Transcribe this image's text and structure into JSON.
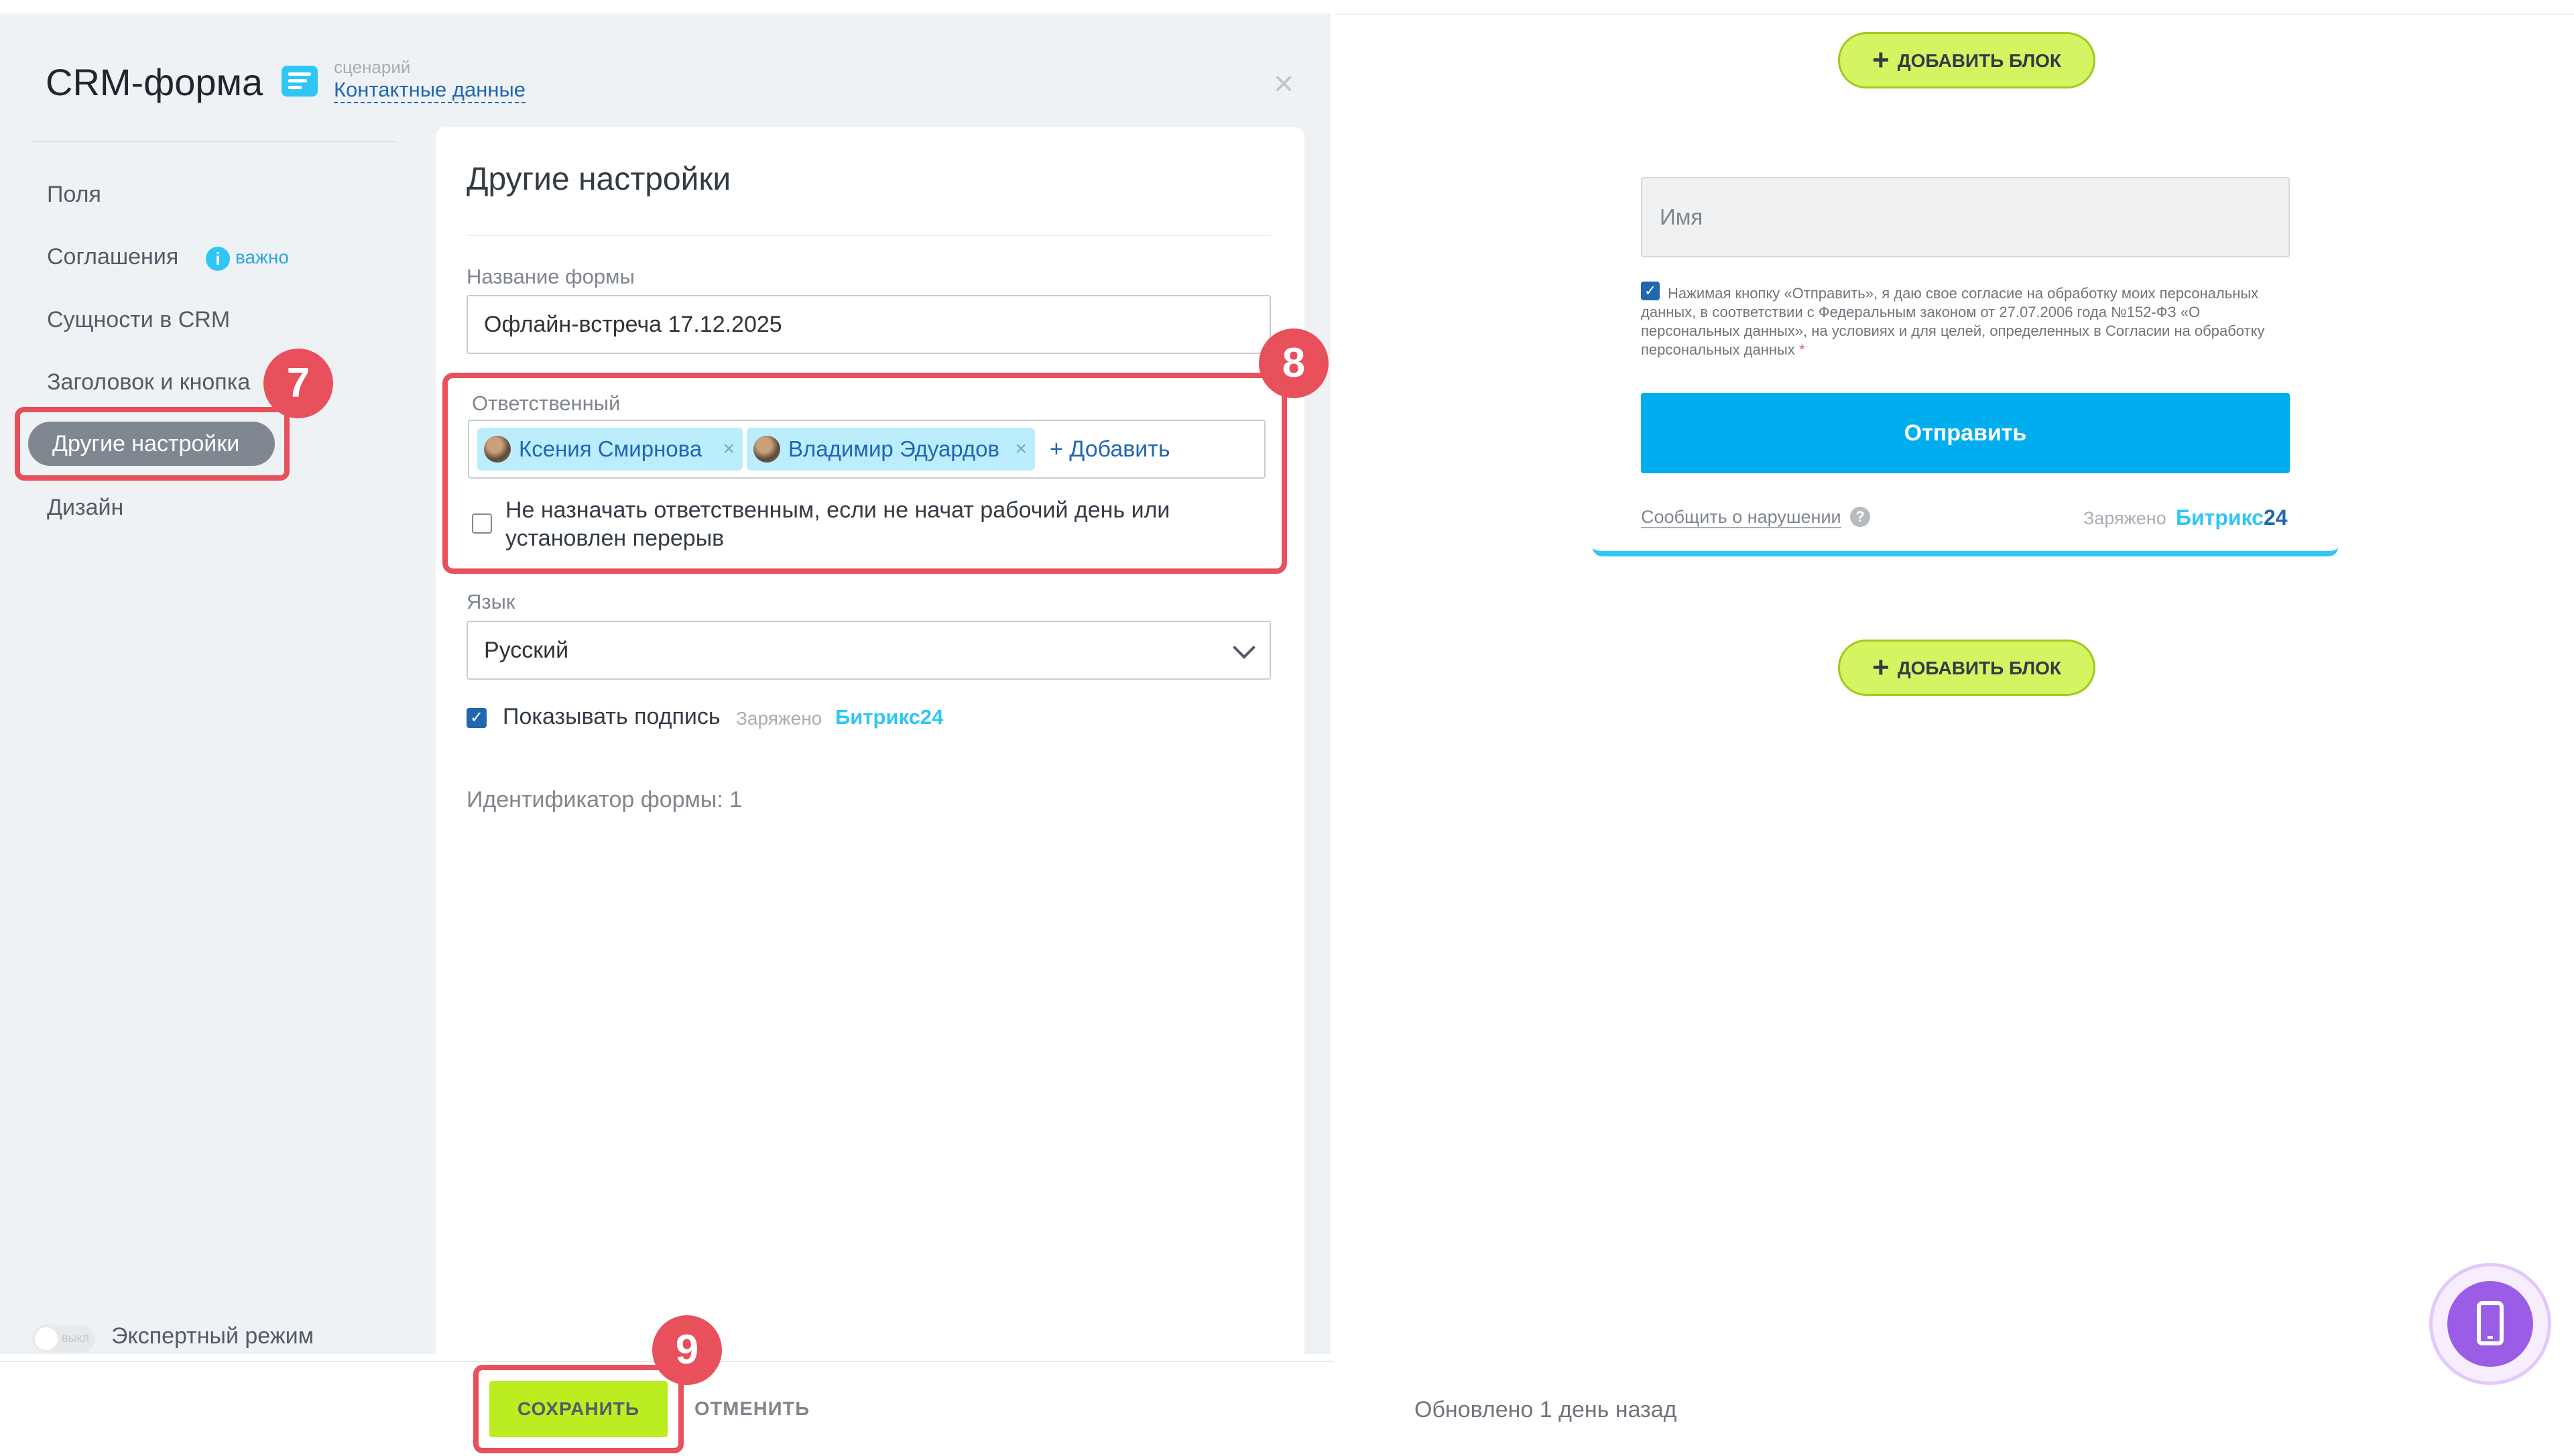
{
  "header": {
    "title": "CRM-форма",
    "scenario_caption": "сценарий",
    "scenario_link": "Контактные данные",
    "close_symbol": "×"
  },
  "nav": {
    "fields": "Поля",
    "agreements": "Соглашения",
    "agreements_badge": "важно",
    "agreements_badge_icon": "i",
    "crm_entities": "Сущности в CRM",
    "header_button": "Заголовок и кнопка",
    "other_settings": "Другие настройки",
    "design": "Дизайн"
  },
  "steps": {
    "step7": "7",
    "step8": "8",
    "step9": "9"
  },
  "settings": {
    "title": "Другие настройки",
    "form_name_label": "Название формы",
    "form_name_value": "Офлайн-встреча 17.12.2025",
    "responsible_label": "Ответственный",
    "responsible": [
      {
        "name": "Ксения Смирнова",
        "remove": "×"
      },
      {
        "name": "Владимир Эдуардов",
        "remove": "×"
      }
    ],
    "add_link": "+ Добавить",
    "no_assign_label": "Не назначать ответственным, если не начат рабочий день или установлен перерыв",
    "no_assign_checked": false,
    "language_label": "Язык",
    "language_value": "Русский",
    "show_signature_label": "Показывать подпись",
    "show_signature_checked": true,
    "signature_charged": "Заряжено",
    "signature_brand": "Битрикс24",
    "form_id_text": "Идентификатор формы: 1"
  },
  "expert_mode": {
    "toggle_text": "выкл",
    "label": "Экспертный режим"
  },
  "footer": {
    "save_label": "СОХРАНИТЬ",
    "cancel_label": "ОТМЕНИТЬ"
  },
  "preview": {
    "add_block_label": "ДОБАВИТЬ БЛОК",
    "add_block_icon": "+",
    "name_placeholder": "Имя",
    "consent_text": "Нажимая кнопку «Отправить», я даю свое согласие на обработку моих персональных данных, в соответствии с Федеральным законом от 27.07.2006 года №152-ФЗ «О персональных данных», на условиях и для целей, определенных в Согласии на обработку персональных данных",
    "consent_required_mark": "*",
    "submit_label": "Отправить",
    "report_link": "Сообщить о нарушении",
    "help_symbol": "?",
    "charged_label": "Заряжено",
    "brand_name": "Битрикс",
    "brand_number": "24",
    "updated_text": "Обновлено 1 день назад"
  },
  "icons": {
    "scenario": "form-list-icon",
    "info": "info-icon",
    "close": "close-icon",
    "chevron": "chevron-down-icon",
    "mobile": "mobile-phone-icon",
    "plus": "plus-icon",
    "check": "✓"
  },
  "colors": {
    "accent_blue": "#2fc6f6",
    "link_blue": "#2067b0",
    "highlight_red": "#e8505b",
    "save_green": "#bbed21",
    "submit_blue": "#00aeef",
    "mobile_purple": "#9b5de5"
  }
}
